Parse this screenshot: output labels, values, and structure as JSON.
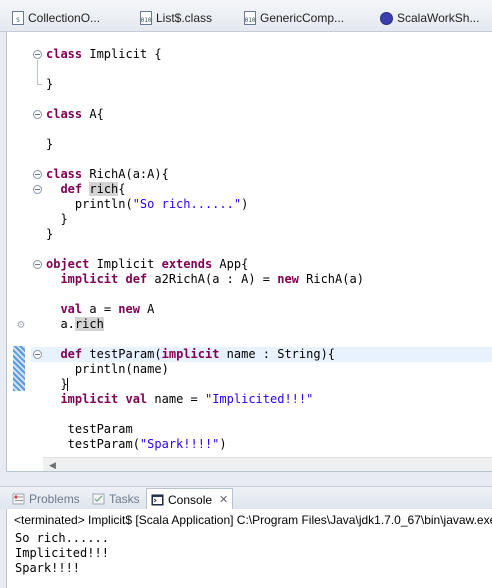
{
  "editor_tabs": [
    {
      "label": "CollectionO...",
      "icon": "scala-file-icon"
    },
    {
      "label": "List$.class",
      "icon": "class-file-icon"
    },
    {
      "label": "GenericComp...",
      "icon": "class-file-icon"
    },
    {
      "label": "ScalaWorkSh...",
      "icon": "scala-worksheet-icon"
    }
  ],
  "code_lines": [
    {
      "tokens": [
        {
          "t": "class",
          "k": "kw"
        },
        {
          "t": " Implicit {"
        }
      ]
    },
    {
      "tokens": [
        {
          "t": ""
        }
      ]
    },
    {
      "tokens": [
        {
          "t": "}"
        }
      ]
    },
    {
      "tokens": [
        {
          "t": ""
        }
      ]
    },
    {
      "tokens": [
        {
          "t": "class",
          "k": "kw"
        },
        {
          "t": " A{"
        }
      ]
    },
    {
      "tokens": [
        {
          "t": ""
        }
      ]
    },
    {
      "tokens": [
        {
          "t": "}"
        }
      ]
    },
    {
      "tokens": [
        {
          "t": ""
        }
      ]
    },
    {
      "tokens": [
        {
          "t": "class",
          "k": "kw"
        },
        {
          "t": " RichA(a:A){"
        }
      ]
    },
    {
      "tokens": [
        {
          "t": "  "
        },
        {
          "t": "def",
          "k": "kw"
        },
        {
          "t": " "
        },
        {
          "t": "rich",
          "k": "occ"
        },
        {
          "t": "{"
        }
      ]
    },
    {
      "tokens": [
        {
          "t": "    println("
        },
        {
          "t": "\"So rich......\"",
          "k": "str"
        },
        {
          "t": ")"
        }
      ]
    },
    {
      "tokens": [
        {
          "t": "  }"
        }
      ]
    },
    {
      "tokens": [
        {
          "t": "}"
        }
      ]
    },
    {
      "tokens": [
        {
          "t": ""
        }
      ]
    },
    {
      "tokens": [
        {
          "t": "object",
          "k": "kw"
        },
        {
          "t": " Implicit "
        },
        {
          "t": "extends",
          "k": "kw"
        },
        {
          "t": " App{"
        }
      ]
    },
    {
      "tokens": [
        {
          "t": "  "
        },
        {
          "t": "implicit",
          "k": "kw"
        },
        {
          "t": " "
        },
        {
          "t": "def",
          "k": "kw"
        },
        {
          "t": " a2RichA(a : A) = "
        },
        {
          "t": "new",
          "k": "kw"
        },
        {
          "t": " RichA(a)"
        }
      ]
    },
    {
      "tokens": [
        {
          "t": ""
        }
      ]
    },
    {
      "tokens": [
        {
          "t": "  "
        },
        {
          "t": "val",
          "k": "kw"
        },
        {
          "t": " a = "
        },
        {
          "t": "new",
          "k": "kw"
        },
        {
          "t": " A"
        }
      ]
    },
    {
      "tokens": [
        {
          "t": "  a."
        },
        {
          "t": "rich",
          "k": "occ"
        }
      ]
    },
    {
      "tokens": [
        {
          "t": ""
        }
      ]
    },
    {
      "tokens": [
        {
          "t": "  "
        },
        {
          "t": "def",
          "k": "kw"
        },
        {
          "t": " testParam("
        },
        {
          "t": "implicit",
          "k": "kw"
        },
        {
          "t": " name : String){"
        }
      ]
    },
    {
      "tokens": [
        {
          "t": "    println(name)"
        }
      ]
    },
    {
      "tokens": [
        {
          "t": "  }"
        }
      ]
    },
    {
      "tokens": [
        {
          "t": "  "
        },
        {
          "t": "implicit",
          "k": "kw"
        },
        {
          "t": " "
        },
        {
          "t": "val",
          "k": "kw"
        },
        {
          "t": " name = "
        },
        {
          "t": "\"Implicited!!!\"",
          "k": "str"
        }
      ]
    },
    {
      "tokens": [
        {
          "t": ""
        }
      ]
    },
    {
      "tokens": [
        {
          "t": "   testParam"
        }
      ]
    },
    {
      "tokens": [
        {
          "t": "   testParam("
        },
        {
          "t": "\"Spark!!!!\"",
          "k": "str"
        },
        {
          "t": ")"
        }
      ]
    }
  ],
  "view_tabs": [
    {
      "label": "Problems",
      "icon": "problems-icon",
      "active": false
    },
    {
      "label": "Tasks",
      "icon": "tasks-icon",
      "active": false
    },
    {
      "label": "Console",
      "icon": "console-icon",
      "active": true
    }
  ],
  "console": {
    "status": "<terminated> Implicit$ [Scala Application] C:\\Program Files\\Java\\jdk1.7.0_67\\bin\\javaw.exe",
    "output": [
      "So rich......",
      "Implicited!!!",
      "Spark!!!!"
    ]
  },
  "colors": {
    "keyword": "#7f0055",
    "string": "#2a00ff",
    "current_line": "#e8f2fe",
    "occurrence": "#d4d4d4"
  }
}
